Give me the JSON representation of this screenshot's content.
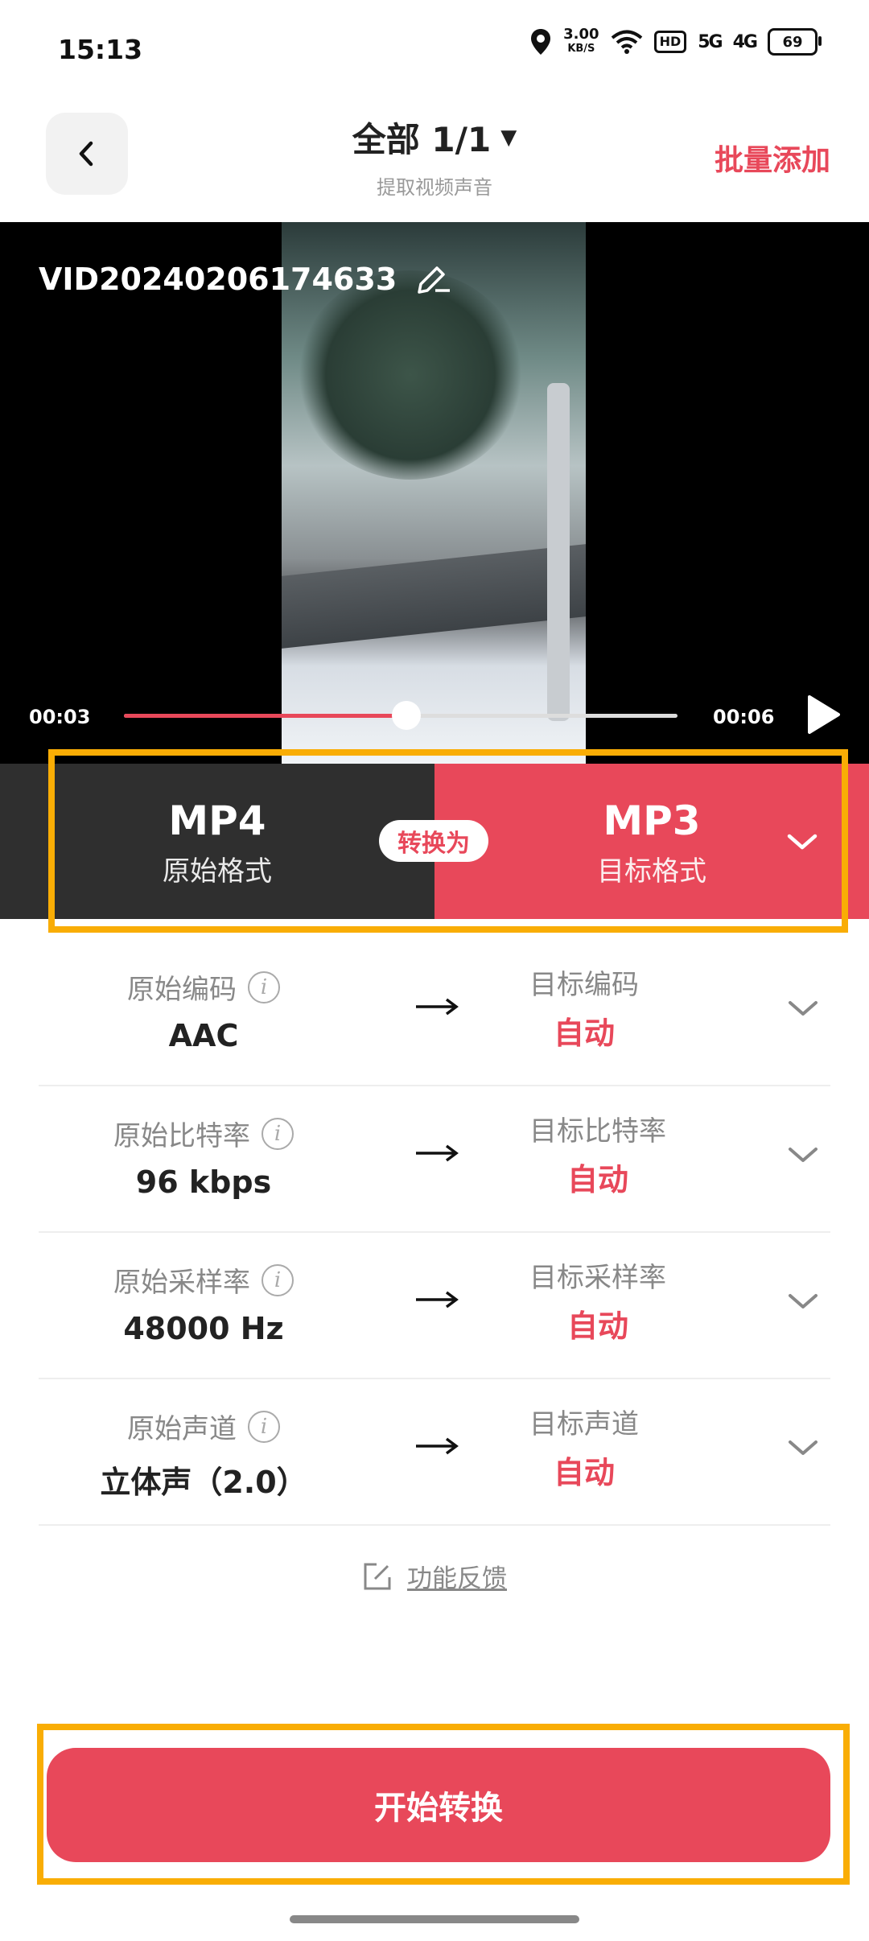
{
  "status_bar": {
    "time": "15:13",
    "net_speed_value": "3.00",
    "net_speed_unit": "KB/S",
    "hd": "HD",
    "signal1": "5G",
    "signal2": "4G",
    "battery": "69"
  },
  "header": {
    "title": "全部 1/1",
    "subtitle": "提取视频声音",
    "batch_add": "批量添加"
  },
  "video": {
    "filename": "VID20240206174633",
    "current_time": "00:03",
    "total_time": "00:06",
    "progress": 0.51
  },
  "format": {
    "source_name": "MP4",
    "source_label": "原始格式",
    "convert_label": "转换为",
    "target_name": "MP3",
    "target_label": "目标格式"
  },
  "params": [
    {
      "src_label": "原始编码",
      "src_value": "AAC",
      "dst_label": "目标编码",
      "dst_value": "自动"
    },
    {
      "src_label": "原始比特率",
      "src_value": "96 kbps",
      "dst_label": "目标比特率",
      "dst_value": "自动"
    },
    {
      "src_label": "原始采样率",
      "src_value": "48000 Hz",
      "dst_label": "目标采样率",
      "dst_value": "自动"
    },
    {
      "src_label": "原始声道",
      "src_value": "立体声（2.0）",
      "dst_label": "目标声道",
      "dst_value": "自动"
    }
  ],
  "feedback": "功能反馈",
  "start_button": "开始转换",
  "colors": {
    "accent": "#e8485a",
    "dark_panel": "#2f2f2f",
    "highlight": "#f9ad05"
  }
}
